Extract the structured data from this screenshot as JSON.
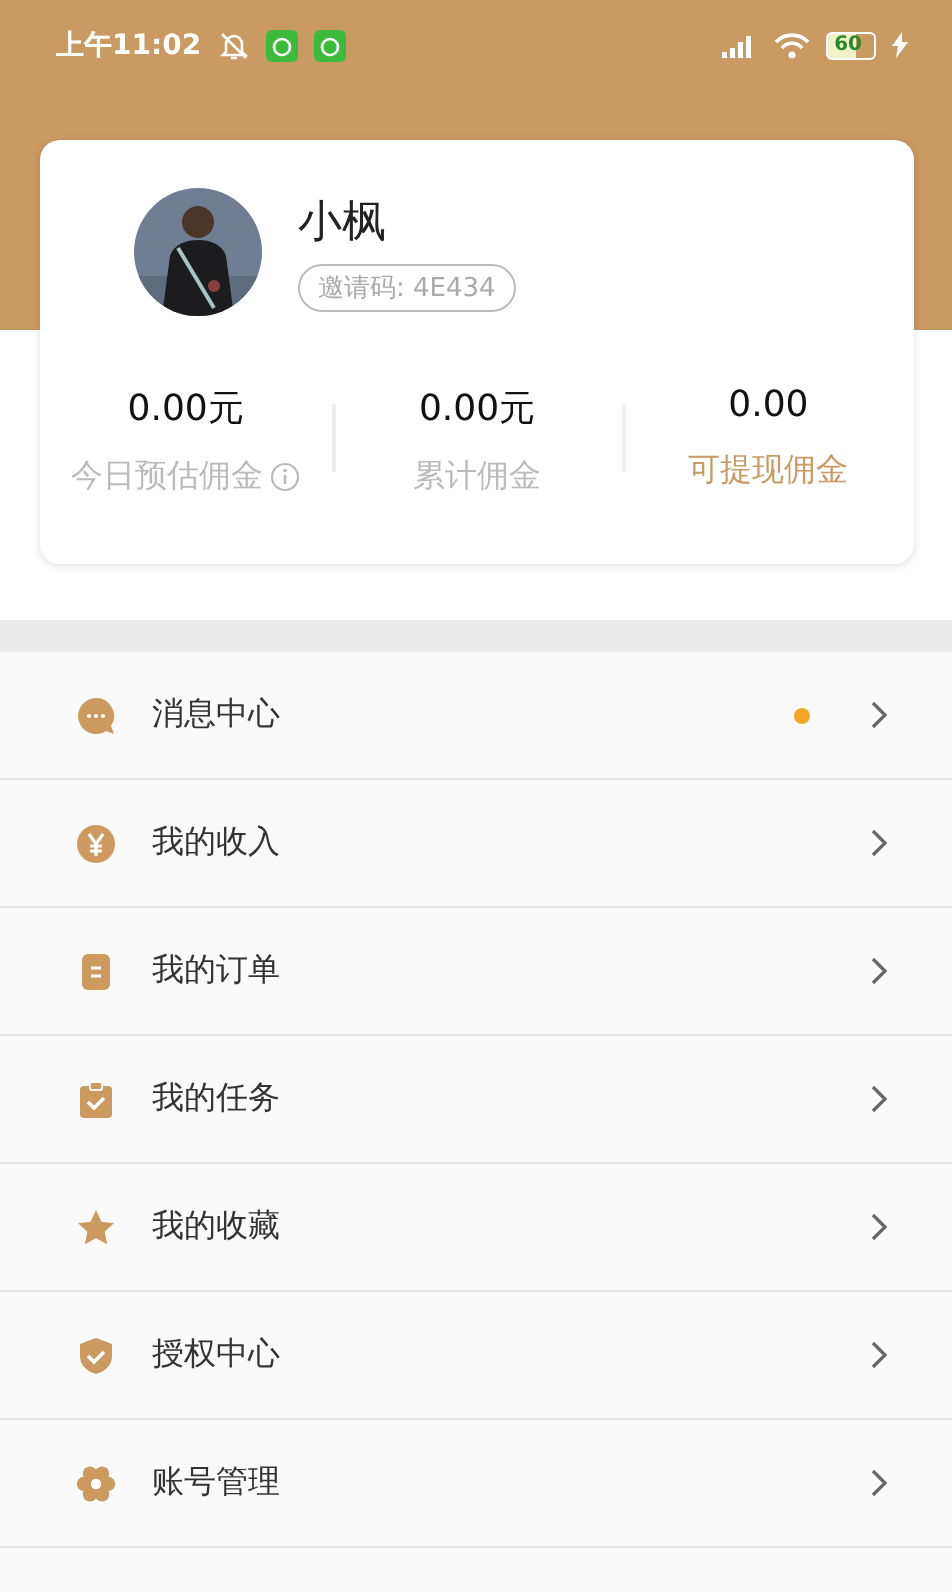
{
  "status_bar": {
    "time": "上午11:02",
    "battery": "60"
  },
  "profile": {
    "name": "小枫",
    "invite_code": "邀请码: 4E434"
  },
  "stats": [
    {
      "value": "0.00元",
      "label": "今日预估佣金",
      "info": true,
      "highlight": false
    },
    {
      "value": "0.00元",
      "label": "累计佣金",
      "info": false,
      "highlight": false
    },
    {
      "value": "0.00",
      "label": "可提现佣金",
      "info": false,
      "highlight": true
    }
  ],
  "menu": [
    {
      "kind": "chat",
      "label": "消息中心",
      "unread": true
    },
    {
      "kind": "yen",
      "label": "我的收入",
      "unread": false
    },
    {
      "kind": "clipboard",
      "label": "我的订单",
      "unread": false
    },
    {
      "kind": "task",
      "label": "我的任务",
      "unread": false
    },
    {
      "kind": "star",
      "label": "我的收藏",
      "unread": false
    },
    {
      "kind": "shield",
      "label": "授权中心",
      "unread": false
    },
    {
      "kind": "gear",
      "label": "账号管理",
      "unread": false
    }
  ]
}
